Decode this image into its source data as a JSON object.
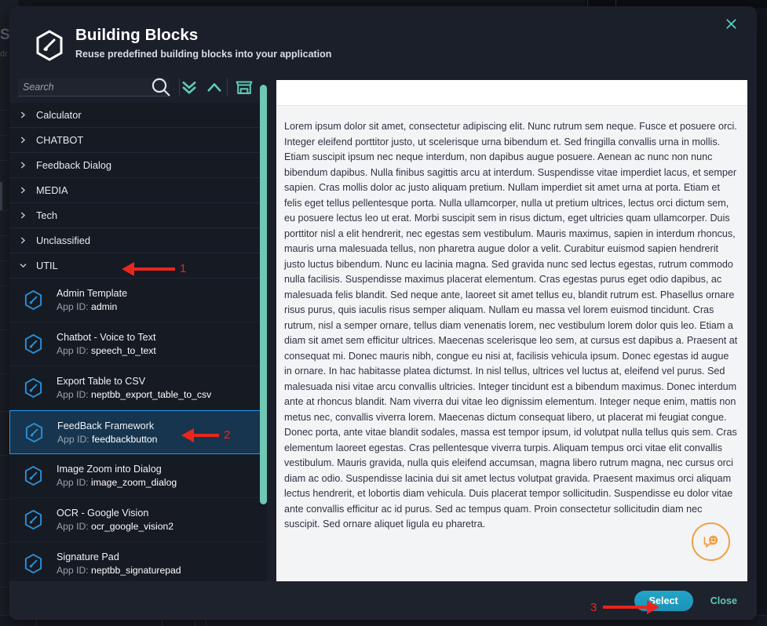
{
  "dialog": {
    "title": "Building Blocks",
    "subtitle": "Reuse predefined building blocks into your application",
    "logo_icon": "hexagon-block-logo",
    "close_icon": "close-icon"
  },
  "toolbar": {
    "search_placeholder": "Search",
    "search_value": "",
    "search_icon": "search-icon",
    "expand_all_icon": "double-chevron-down-icon",
    "collapse_all_icon": "chevron-up-icon",
    "store_icon": "store-icon"
  },
  "categories": [
    {
      "label": "Calculator",
      "expanded": false
    },
    {
      "label": "CHATBOT",
      "expanded": false
    },
    {
      "label": "Feedback Dialog",
      "expanded": false
    },
    {
      "label": "MEDIA",
      "expanded": false
    },
    {
      "label": "Tech",
      "expanded": false
    },
    {
      "label": "Unclassified",
      "expanded": false
    },
    {
      "label": "UTIL",
      "expanded": true
    }
  ],
  "blocks": [
    {
      "name": "Admin Template",
      "id_label": "App ID:",
      "id_value": "admin",
      "selected": false
    },
    {
      "name": "Chatbot - Voice to Text",
      "id_label": "App ID:",
      "id_value": "speech_to_text",
      "selected": false
    },
    {
      "name": "Export Table to CSV",
      "id_label": "App ID:",
      "id_value": "neptbb_export_table_to_csv",
      "selected": false
    },
    {
      "name": "FeedBack Framework",
      "id_label": "App ID:",
      "id_value": "feedbackbutton",
      "selected": true
    },
    {
      "name": "Image Zoom into Dialog",
      "id_label": "App ID:",
      "id_value": "image_zoom_dialog",
      "selected": false
    },
    {
      "name": "OCR - Google Vision",
      "id_label": "App ID:",
      "id_value": "ocr_google_vision2",
      "selected": false
    },
    {
      "name": "Signature Pad",
      "id_label": "App ID:",
      "id_value": "neptbb_signaturepad",
      "selected": false
    }
  ],
  "preview": {
    "body_text": "Lorem ipsum dolor sit amet, consectetur adipiscing elit. Nunc rutrum sem neque. Fusce et posuere orci. Integer eleifend porttitor justo, ut scelerisque urna bibendum et. Sed fringilla convallis urna in mollis. Etiam suscipit ipsum nec neque interdum, non dapibus augue posuere. Aenean ac nunc non nunc bibendum dapibus. Nulla finibus sagittis arcu at interdum. Suspendisse vitae imperdiet lacus, et semper sapien. Cras mollis dolor ac justo aliquam pretium. Nullam imperdiet sit amet urna at porta. Etiam et felis eget tellus pellentesque porta. Nulla ullamcorper, nulla ut pretium ultrices, lectus orci dictum sem, eu posuere lectus leo ut erat. Morbi suscipit sem in risus dictum, eget ultricies quam ullamcorper. Duis porttitor nisl a elit hendrerit, nec egestas sem vestibulum. Mauris maximus, sapien in interdum rhoncus, mauris urna malesuada tellus, non pharetra augue dolor a velit. Curabitur euismod sapien hendrerit justo luctus bibendum.  Nunc eu lacinia magna. Sed gravida nunc sed lectus egestas, rutrum commodo nulla facilisis. Suspendisse maximus placerat elementum. Cras egestas purus eget odio dapibus, ac malesuada felis blandit. Sed neque ante, laoreet sit amet tellus eu, blandit rutrum est. Phasellus ornare risus purus, quis iaculis risus semper aliquam. Nullam eu massa vel lorem euismod tincidunt. Cras rutrum, nisl a semper ornare, tellus diam venenatis lorem, nec vestibulum lorem dolor quis leo. Etiam a diam sit amet sem efficitur ultrices. Maecenas scelerisque leo sem, at cursus est dapibus a.  Praesent at consequat mi. Donec mauris nibh, congue eu nisi at, facilisis vehicula ipsum. Donec egestas id augue in ornare. In hac habitasse platea dictumst. In nisl tellus, ultrices vel luctus at, eleifend vel purus. Sed malesuada nisi vitae arcu convallis ultricies. Integer tincidunt est a bibendum maximus. Donec interdum ante at rhoncus blandit. Nam viverra dui vitae leo dignissim elementum. Integer neque enim, mattis non metus nec, convallis viverra lorem. Maecenas dictum consequat libero, ut placerat mi feugiat congue. Donec porta, ante vitae blandit sodales, massa est tempor ipsum, id volutpat nulla tellus quis sem.  Cras elementum laoreet egestas. Cras pellentesque viverra turpis. Aliquam tempus orci vitae elit convallis vestibulum. Mauris gravida, nulla quis eleifend accumsan, magna libero rutrum magna, nec cursus orci diam ac odio. Suspendisse lacinia dui sit amet lectus volutpat gravida. Praesent maximus orci aliquam lectus hendrerit, et lobortis diam vehicula. Duis placerat tempor sollicitudin. Suspendisse eu dolor vitae ante convallis efficitur ac id purus. Sed ac tempus quam. Proin consectetur sollicitudin diam nec suscipit. Sed ornare aliquet ligula eu pharetra.",
    "feedback_fab_icon": "chat-smiley-feedback-icon"
  },
  "footer": {
    "select_label": "Select",
    "close_label": "Close"
  },
  "annotations": [
    {
      "number": "1"
    },
    {
      "number": "2"
    },
    {
      "number": "3"
    }
  ],
  "colors": {
    "accent_teal": "#5ec8b6",
    "select_button": "#1b93b8",
    "selection_border": "#2196f3",
    "annotation_red": "#e8261c",
    "fab_orange": "#f0a042",
    "block_icon_blue": "#2b8fd6"
  }
}
